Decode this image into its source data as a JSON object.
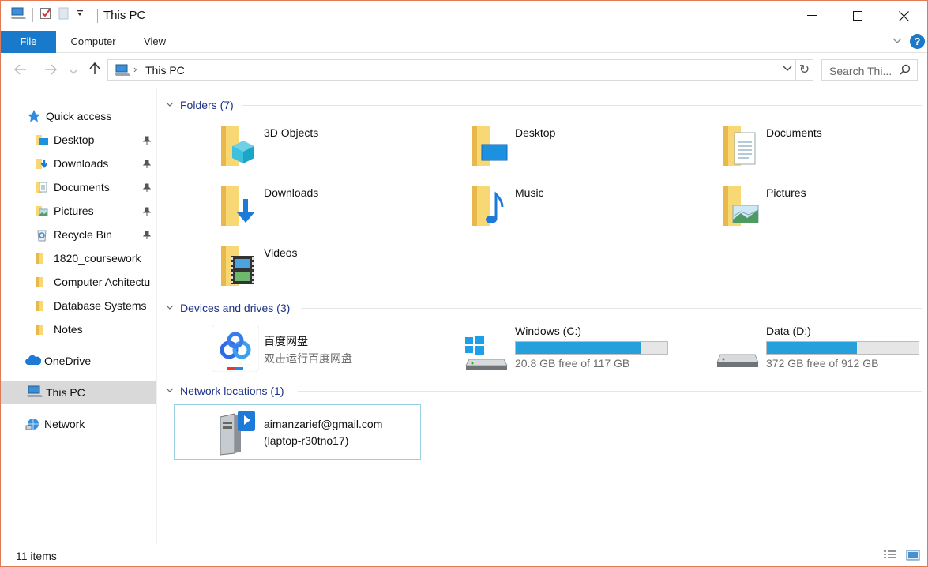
{
  "window": {
    "title": "This PC",
    "controls": {
      "minimize": "—",
      "maximize": "☐",
      "close": "✕"
    }
  },
  "ribbon": {
    "tabs": [
      "File",
      "Computer",
      "View"
    ],
    "collapse_glyph": "∨",
    "help_glyph": "?"
  },
  "nav": {
    "back": "←",
    "forward": "→",
    "recent": "⌄",
    "up": "↑",
    "address_chevron": "›",
    "address_text": "This PC",
    "address_dropdown": "∨",
    "refresh": "↻",
    "search_placeholder": "Search Thi..."
  },
  "sidebar": {
    "quick_access": "Quick access",
    "items": [
      {
        "label": "Desktop",
        "pinned": true,
        "icon": "desktop-folder-icon"
      },
      {
        "label": "Downloads",
        "pinned": true,
        "icon": "downloads-folder-icon"
      },
      {
        "label": "Documents",
        "pinned": true,
        "icon": "documents-folder-icon"
      },
      {
        "label": "Pictures",
        "pinned": true,
        "icon": "pictures-folder-icon"
      },
      {
        "label": "Recycle Bin",
        "pinned": true,
        "icon": "recycle-bin-icon"
      },
      {
        "label": "1820_coursework",
        "pinned": false,
        "icon": "folder-icon"
      },
      {
        "label": "Computer Achitectu",
        "pinned": false,
        "icon": "folder-icon"
      },
      {
        "label": "Database Systems",
        "pinned": false,
        "icon": "folder-icon"
      },
      {
        "label": "Notes",
        "pinned": false,
        "icon": "folder-icon"
      }
    ],
    "onedrive": "OneDrive",
    "this_pc": "This PC",
    "network": "Network"
  },
  "groups": {
    "folders": "Folders (7)",
    "devices": "Devices and drives (3)",
    "network": "Network locations (1)"
  },
  "folders": [
    {
      "label": "3D Objects"
    },
    {
      "label": "Desktop"
    },
    {
      "label": "Documents"
    },
    {
      "label": "Downloads"
    },
    {
      "label": "Music"
    },
    {
      "label": "Pictures"
    },
    {
      "label": "Videos"
    }
  ],
  "drives": {
    "baidu": {
      "name": "百度网盘",
      "sub": "双击运行百度网盘"
    },
    "windows": {
      "name": "Windows (C:)",
      "free": "20.8 GB free of 117 GB",
      "used_fraction": 0.822
    },
    "data": {
      "name": "Data (D:)",
      "free": "372 GB free of 912 GB",
      "used_fraction": 0.592
    }
  },
  "network_location": {
    "line1": "aimanzarief@gmail.com",
    "line2": "(laptop-r30tno17)"
  },
  "status": {
    "items": "11 items"
  },
  "colors": {
    "accent": "#1979ca",
    "drive_bar": "#26a0da",
    "group_header": "#1e3287",
    "selection": "#d9d9d9",
    "folder_yellow": "#f8d775"
  }
}
